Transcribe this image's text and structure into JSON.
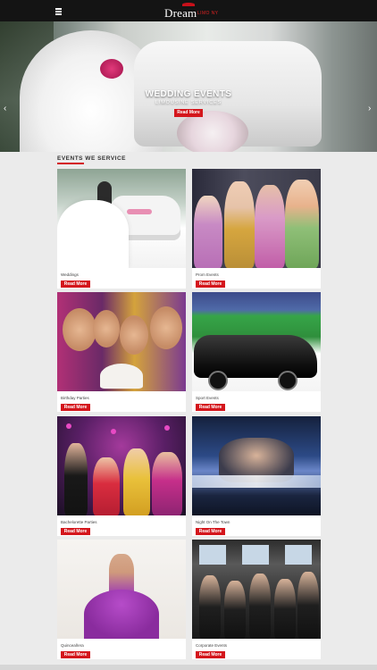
{
  "header": {
    "logo_word": "Dream",
    "logo_sub": "LIMO NY",
    "menu_icon": "hamburger-menu-icon"
  },
  "hero": {
    "title": "WEDDING EVENTS",
    "subtitle": "LIMOUSINE SERVICES",
    "button": "Read More",
    "prev_icon": "chevron-left-icon",
    "next_icon": "chevron-right-icon"
  },
  "section": {
    "title": "EVENTS WE SERVICE"
  },
  "events": [
    {
      "label": "Weddings",
      "button": "Read More"
    },
    {
      "label": "Prom Events",
      "button": "Read More"
    },
    {
      "label": "Birthday Parties",
      "button": "Read More"
    },
    {
      "label": "Sport Events",
      "button": "Read More"
    },
    {
      "label": "Bachelorette Parties",
      "button": "Read More"
    },
    {
      "label": "Night On The Town",
      "button": "Read More"
    },
    {
      "label": "Quinceañera",
      "button": "Read More"
    },
    {
      "label": "Corporate Events",
      "button": "Read More"
    }
  ],
  "colors": {
    "accent": "#d4161c",
    "topbar": "#141414",
    "page_bg": "#ebebeb"
  }
}
